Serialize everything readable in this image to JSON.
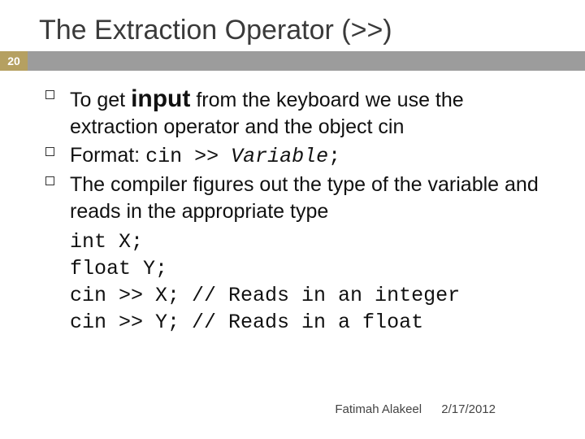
{
  "slide": {
    "title": "The Extraction Operator (>>)",
    "number": "20",
    "bullets": {
      "b1_pre": "To get ",
      "b1_em": "input",
      "b1_post": " from the keyboard we use the extraction operator and the object cin",
      "b2_pre": "Format: ",
      "b2_code_a": "cin >> ",
      "b2_code_var": "Variable",
      "b2_code_b": ";",
      "b3": "The compiler figures out the type of the variable and reads in the appropriate type"
    },
    "code": {
      "l1": "int X;",
      "l2": "float Y;",
      "l3": "cin >> X; // Reads in an integer",
      "l4": "cin >> Y; // Reads in a float"
    },
    "footer": {
      "author": "Fatimah Alakeel",
      "date": "2/17/2012"
    }
  }
}
